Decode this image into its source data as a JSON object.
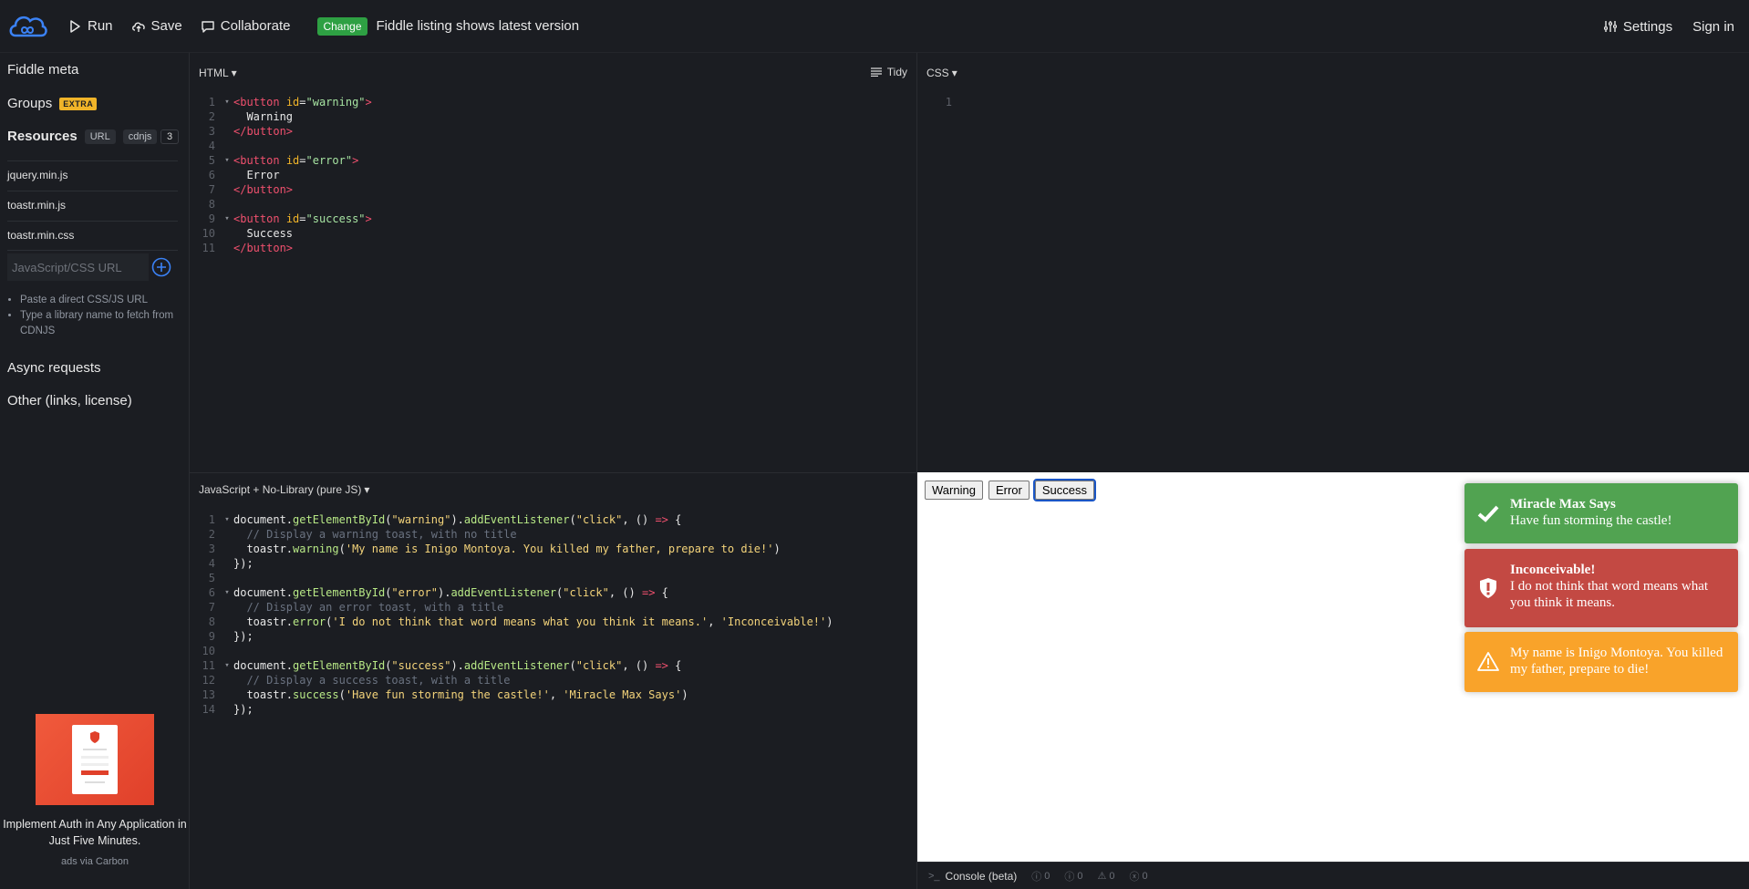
{
  "topbar": {
    "run_label": "Run",
    "save_label": "Save",
    "collaborate_label": "Collaborate",
    "change_badge": "Change",
    "change_text": "Fiddle listing shows latest version",
    "settings_label": "Settings",
    "signin_label": "Sign in"
  },
  "sidebar": {
    "fiddle_meta": "Fiddle meta",
    "groups": "Groups",
    "groups_badge": "EXTRA",
    "resources": "Resources",
    "chip_url": "URL",
    "chip_cdnjs": "cdnjs",
    "resources_count": "3",
    "files": [
      "jquery.min.js",
      "toastr.min.js",
      "toastr.min.css"
    ],
    "url_placeholder": "JavaScript/CSS URL",
    "hints": [
      "Paste a direct CSS/JS URL",
      "Type a library name to fetch from CDNJS"
    ],
    "async_requests": "Async requests",
    "other": "Other (links, license)",
    "ad_text": "Implement Auth in Any Application in Just Five Minutes.",
    "ad_via": "ads via Carbon"
  },
  "html_pane": {
    "title": "HTML",
    "tidy": "Tidy",
    "lines": [
      {
        "n": "1",
        "fold": true,
        "parts": [
          [
            "tag",
            "<button"
          ],
          [
            "plain",
            " "
          ],
          [
            "attr",
            "id"
          ],
          [
            "plain",
            "="
          ],
          [
            "str",
            "\"warning\""
          ],
          [
            "tag",
            ">"
          ]
        ]
      },
      {
        "n": "2",
        "parts": [
          [
            "txt",
            "  Warning"
          ]
        ]
      },
      {
        "n": "3",
        "parts": [
          [
            "tag",
            "</button>"
          ]
        ]
      },
      {
        "n": "4",
        "parts": []
      },
      {
        "n": "5",
        "fold": true,
        "parts": [
          [
            "tag",
            "<button"
          ],
          [
            "plain",
            " "
          ],
          [
            "attr",
            "id"
          ],
          [
            "plain",
            "="
          ],
          [
            "str",
            "\"error\""
          ],
          [
            "tag",
            ">"
          ]
        ]
      },
      {
        "n": "6",
        "parts": [
          [
            "txt",
            "  Error"
          ]
        ]
      },
      {
        "n": "7",
        "parts": [
          [
            "tag",
            "</button>"
          ]
        ]
      },
      {
        "n": "8",
        "parts": []
      },
      {
        "n": "9",
        "fold": true,
        "parts": [
          [
            "tag",
            "<button"
          ],
          [
            "plain",
            " "
          ],
          [
            "attr",
            "id"
          ],
          [
            "plain",
            "="
          ],
          [
            "str",
            "\"success\""
          ],
          [
            "tag",
            ">"
          ]
        ]
      },
      {
        "n": "10",
        "parts": [
          [
            "txt",
            "  Success"
          ]
        ]
      },
      {
        "n": "11",
        "parts": [
          [
            "tag",
            "</button>"
          ]
        ]
      }
    ]
  },
  "css_pane": {
    "title": "CSS",
    "lines": [
      {
        "n": "1",
        "parts": []
      }
    ]
  },
  "js_pane": {
    "title": "JavaScript + No-Library (pure JS)",
    "lines": [
      {
        "n": "1",
        "fold": true,
        "parts": [
          [
            "plain",
            "document."
          ],
          [
            "fn",
            "getElementById"
          ],
          [
            "plain",
            "("
          ],
          [
            "js-str",
            "\"warning\""
          ],
          [
            "plain",
            ")."
          ],
          [
            "fn",
            "addEventListener"
          ],
          [
            "plain",
            "("
          ],
          [
            "js-str",
            "\"click\""
          ],
          [
            "plain",
            ", () "
          ],
          [
            "kw",
            "=>"
          ],
          [
            "plain",
            " {"
          ]
        ]
      },
      {
        "n": "2",
        "parts": [
          [
            "cmt",
            "  // Display a warning toast, with no title"
          ]
        ]
      },
      {
        "n": "3",
        "parts": [
          [
            "plain",
            "  toastr."
          ],
          [
            "fn",
            "warning"
          ],
          [
            "plain",
            "("
          ],
          [
            "js-str",
            "'My name is Inigo Montoya. You killed my father, prepare to die!'"
          ],
          [
            "plain",
            ")"
          ]
        ]
      },
      {
        "n": "4",
        "parts": [
          [
            "plain",
            "});"
          ]
        ]
      },
      {
        "n": "5",
        "parts": []
      },
      {
        "n": "6",
        "fold": true,
        "parts": [
          [
            "plain",
            "document."
          ],
          [
            "fn",
            "getElementById"
          ],
          [
            "plain",
            "("
          ],
          [
            "js-str",
            "\"error\""
          ],
          [
            "plain",
            ")."
          ],
          [
            "fn",
            "addEventListener"
          ],
          [
            "plain",
            "("
          ],
          [
            "js-str",
            "\"click\""
          ],
          [
            "plain",
            ", () "
          ],
          [
            "kw",
            "=>"
          ],
          [
            "plain",
            " {"
          ]
        ]
      },
      {
        "n": "7",
        "parts": [
          [
            "cmt",
            "  // Display an error toast, with a title"
          ]
        ]
      },
      {
        "n": "8",
        "parts": [
          [
            "plain",
            "  toastr."
          ],
          [
            "fn",
            "error"
          ],
          [
            "plain",
            "("
          ],
          [
            "js-str",
            "'I do not think that word means what you think it means.'"
          ],
          [
            "plain",
            ", "
          ],
          [
            "js-str",
            "'Inconceivable!'"
          ],
          [
            "plain",
            ")"
          ]
        ]
      },
      {
        "n": "9",
        "parts": [
          [
            "plain",
            "});"
          ]
        ]
      },
      {
        "n": "10",
        "parts": []
      },
      {
        "n": "11",
        "fold": true,
        "parts": [
          [
            "plain",
            "document."
          ],
          [
            "fn",
            "getElementById"
          ],
          [
            "plain",
            "("
          ],
          [
            "js-str",
            "\"success\""
          ],
          [
            "plain",
            ")."
          ],
          [
            "fn",
            "addEventListener"
          ],
          [
            "plain",
            "("
          ],
          [
            "js-str",
            "\"click\""
          ],
          [
            "plain",
            ", () "
          ],
          [
            "kw",
            "=>"
          ],
          [
            "plain",
            " {"
          ]
        ]
      },
      {
        "n": "12",
        "parts": [
          [
            "cmt",
            "  // Display a success toast, with a title"
          ]
        ]
      },
      {
        "n": "13",
        "parts": [
          [
            "plain",
            "  toastr."
          ],
          [
            "fn",
            "success"
          ],
          [
            "plain",
            "("
          ],
          [
            "js-str",
            "'Have fun storming the castle!'"
          ],
          [
            "plain",
            ", "
          ],
          [
            "js-str",
            "'Miracle Max Says'"
          ],
          [
            "plain",
            ")"
          ]
        ]
      },
      {
        "n": "14",
        "parts": [
          [
            "plain",
            "});"
          ]
        ]
      }
    ]
  },
  "result": {
    "buttons": [
      "Warning",
      "Error",
      "Success"
    ],
    "toasts": {
      "success": {
        "title": "Miracle Max Says",
        "message": "Have fun storming the castle!",
        "color": "#51a351"
      },
      "error": {
        "title": "Inconceivable!",
        "message": "I do not think that word means what you think it means.",
        "color": "#bd362f"
      },
      "warning": {
        "title": "",
        "message": "My name is Inigo Montoya. You killed my father, prepare to die!",
        "color": "#f89406"
      }
    }
  },
  "console": {
    "label": "Console (beta)",
    "counts": [
      "0",
      "0",
      "0",
      "0"
    ]
  },
  "colors": {
    "accent_blue": "#3b82f6",
    "change_green": "#2ea043",
    "extra_yellow": "#f0b429"
  }
}
